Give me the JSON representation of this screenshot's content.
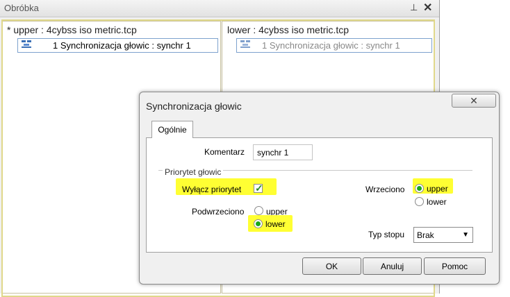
{
  "panel": {
    "title": "Obróbka",
    "pin_glyph": "📌",
    "close_glyph": "✕"
  },
  "upper_pane": {
    "heading": "* upper : 4cybss iso metric.tcp",
    "items": [
      {
        "label": "1 Synchronizacja głowic : synchr 1",
        "icon": "sync-tree-icon"
      }
    ]
  },
  "lower_pane": {
    "heading": "lower : 4cybss iso metric.tcp",
    "items": [
      {
        "label": "1 Synchronizacja głowic : synchr 1",
        "icon": "sync-tree-icon"
      }
    ]
  },
  "dialog": {
    "title": "Synchronizacja głowic",
    "close_glyph": "✕",
    "tabs": [
      {
        "label": "Ogólnie",
        "active": true
      }
    ],
    "comment": {
      "label": "Komentarz",
      "value": "synchr 1"
    },
    "group_title": "Priorytet głowic",
    "disable_priority": {
      "label": "Wyłącz priorytet",
      "checked": true
    },
    "spindle": {
      "label": "Wrzeciono",
      "options": [
        "upper",
        "lower"
      ],
      "selected": "upper"
    },
    "subspindle": {
      "label": "Podwrzeciono",
      "options": [
        "upper",
        "lower"
      ],
      "selected": "lower"
    },
    "stop_type": {
      "label": "Typ stopu",
      "value": "Brak"
    },
    "buttons": {
      "ok": "OK",
      "cancel": "Anuluj",
      "help": "Pomoc"
    }
  },
  "colors": {
    "highlight": "#ffff33",
    "radio_selected": "#1aa81a",
    "selection_border": "#7da2ce"
  }
}
